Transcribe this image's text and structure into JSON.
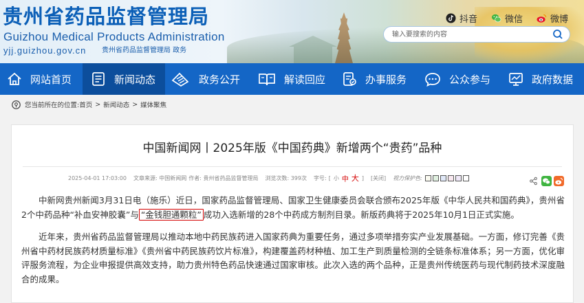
{
  "site": {
    "title_cn": "贵州省药品监督管理局",
    "title_en": "Guizhou Medical Products Administration",
    "url": "yjj.guizhou.gov.cn",
    "sub_label": "贵州省药品监督管理局 政务"
  },
  "social": [
    {
      "label": "抖音",
      "icon": "douyin-icon"
    },
    {
      "label": "微信",
      "icon": "wechat-icon"
    },
    {
      "label": "微博",
      "icon": "weibo-icon"
    }
  ],
  "search": {
    "placeholder": "输入要搜索的内容"
  },
  "nav": [
    {
      "label": "网站首页",
      "icon": "home-icon"
    },
    {
      "label": "新闻动态",
      "icon": "news-icon"
    },
    {
      "label": "政务公开",
      "icon": "document-icon"
    },
    {
      "label": "解读回应",
      "icon": "book-icon"
    },
    {
      "label": "办事服务",
      "icon": "service-icon"
    },
    {
      "label": "公众参与",
      "icon": "chat-icon"
    },
    {
      "label": "政府数据",
      "icon": "data-icon"
    }
  ],
  "breadcrumb": {
    "prefix": "您当前所在的位置:",
    "items": [
      "首页",
      "新闻动态",
      "媒体聚焦"
    ]
  },
  "article": {
    "title": "中国新闻网丨2025年版《中国药典》新增两个“贵药”品种",
    "meta": {
      "date": "2025-04-01 17:03:00",
      "source": "文章来源: 中国新闻网",
      "author": "作者: 贵州省药品监督管理局",
      "views": "浏览次数: 399次",
      "font_label": "字号:",
      "font_open": "[",
      "font_small": "小",
      "font_mid": "中",
      "font_big": "大",
      "font_close": "]",
      "close": "[关闭]",
      "vision": "视力保护色:"
    },
    "swatch_colors": [
      "#fafaf0",
      "#e0f0e0",
      "#e0e8f8",
      "#f8e8f0",
      "#f0e8f8",
      "#ffffff"
    ],
    "paragraph1_a": "中新网贵州新闻3月31日电（施乐）近日，国家药品监督管理局、国家卫生健康委员会联合颁布2025年版《中华人民共和国药典》，贵州省2个中药品种“补血安神胶囊”与",
    "paragraph1_hl": "“金钱胆通颗粒”",
    "paragraph1_b": "成功入选新增的28个中药成方制剂目录。新版药典将于2025年10月1日正式实施。",
    "paragraph2": "近年来，贵州省药品监督管理局以推动本地中药民族药进入国家药典为重要任务，通过多项举措夯实产业发展基础。一方面，修订完善《贵州省中药材民族药材质量标准》《贵州省中药民族药饮片标准》，构建覆盖药材种植、加工生产到质量检测的全链条标准体系；另一方面，优化审评服务流程，为企业申报提供高效支持，助力贵州特色药品快速通过国家审核。此次入选的两个品种，正是贵州传统医药与现代制药技术深度融合的成果。"
  },
  "colors": {
    "nav_bg": "#1466c6",
    "nav_active": "#0c4e9c",
    "logo_blue": "#0b5fb7",
    "highlight_red": "#d40000"
  }
}
